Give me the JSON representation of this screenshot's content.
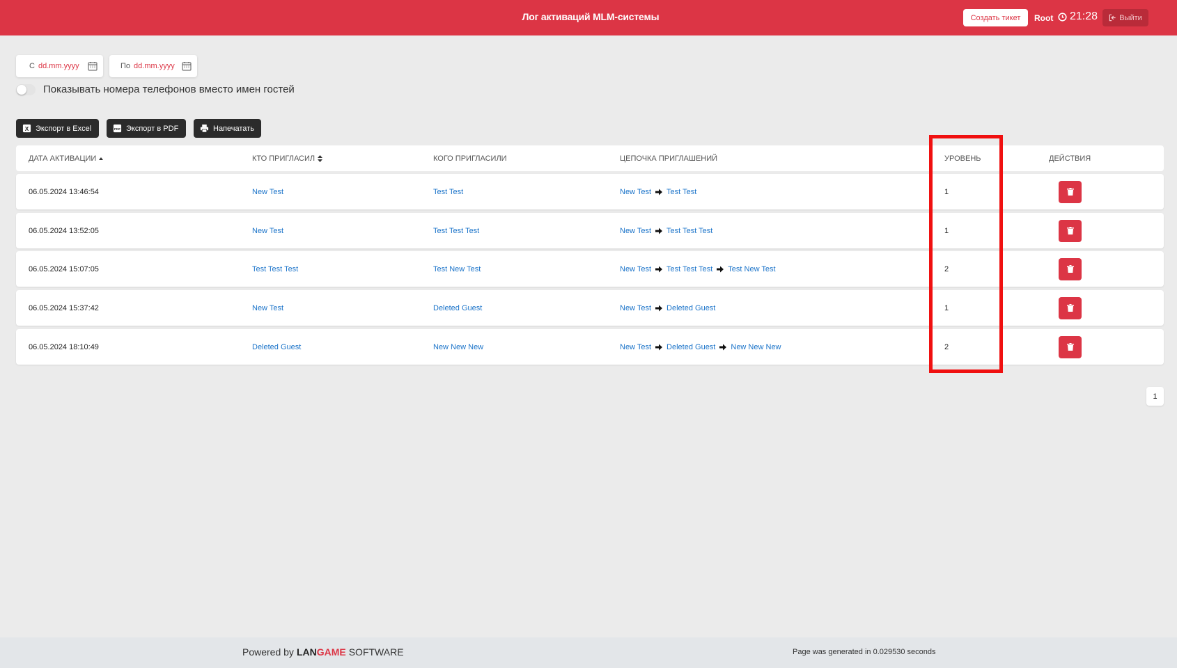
{
  "header": {
    "title": "Лог активаций MLM-системы",
    "ticket_label": "Создать тикет",
    "user": "Root",
    "time": "21:28",
    "logout_label": "Выйти"
  },
  "filters": {
    "from_label": "С",
    "from_placeholder": "dd.mm.yyyy",
    "to_label": "По",
    "to_placeholder": "dd.mm.yyyy",
    "toggle_label": "Показывать номера телефонов вместо имен гостей"
  },
  "exports": {
    "excel": "Экспорт в Excel",
    "pdf": "Экспорт в PDF",
    "print": "Напечатать"
  },
  "table": {
    "columns": [
      "Дата активации",
      "Кто пригласил",
      "Кого пригласили",
      "Цепочка приглашений",
      "Уровень",
      "Действия"
    ],
    "rows": [
      {
        "date": "06.05.2024 13:46:54",
        "inviter": "New Test",
        "invitee": "Test Test",
        "chain": [
          "New Test",
          "Test Test"
        ],
        "level": "1"
      },
      {
        "date": "06.05.2024 13:52:05",
        "inviter": "New Test",
        "invitee": "Test Test Test",
        "chain": [
          "New Test",
          "Test Test Test"
        ],
        "level": "1"
      },
      {
        "date": "06.05.2024 15:07:05",
        "inviter": "Test Test Test",
        "invitee": "Test New Test",
        "chain": [
          "New Test",
          "Test Test Test",
          "Test New Test"
        ],
        "level": "2"
      },
      {
        "date": "06.05.2024 15:37:42",
        "inviter": "New Test",
        "invitee": "Deleted Guest",
        "chain": [
          "New Test",
          "Deleted Guest"
        ],
        "level": "1"
      },
      {
        "date": "06.05.2024 18:10:49",
        "inviter": "Deleted Guest",
        "invitee": "New New New",
        "chain": [
          "New Test",
          "Deleted Guest",
          "New New New"
        ],
        "level": "2"
      }
    ]
  },
  "pagination": {
    "current": "1"
  },
  "footer": {
    "powered_by": "Powered by",
    "brand_lan": "LAN",
    "brand_game": "GAME",
    "brand_software": "SOFTWARE",
    "generated": "Page was generated in 0.029530 seconds"
  },
  "colors": {
    "accent": "#dc3545",
    "link": "#1a73c9",
    "highlight": "#f01010"
  }
}
